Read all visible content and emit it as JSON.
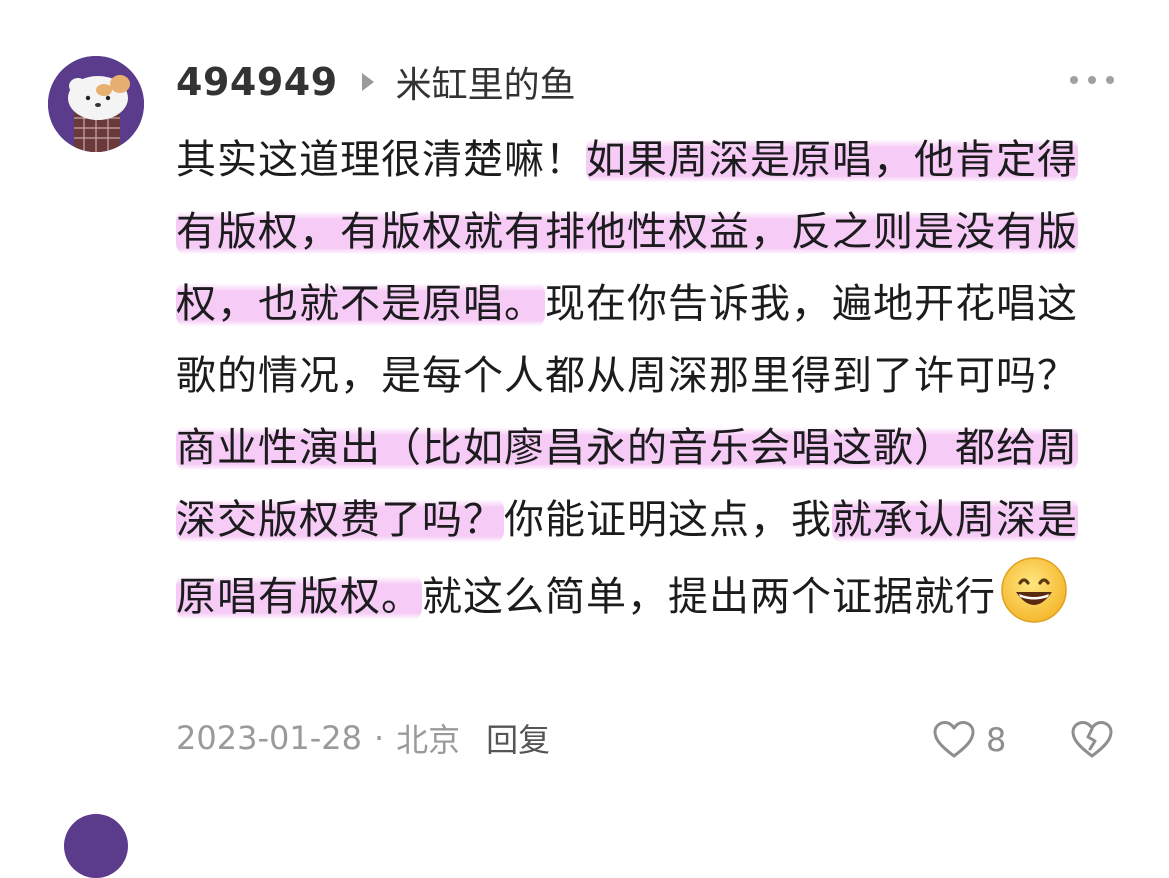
{
  "comment": {
    "username": "494949",
    "reply_to": "米缸里的鱼",
    "segments": [
      {
        "text": "其实这道理很清楚嘛！",
        "highlight": false
      },
      {
        "text": "如果周深是原唱，他肯定得有版权，有版权就有排他性权益，反之则是没有版权，也就不是原唱。",
        "highlight": true
      },
      {
        "text": "现在你告诉我，遍地开花唱这歌的情况，是每个人都从周深那里得到了许可吗？",
        "highlight": false
      },
      {
        "text": "商业性演出（比如廖昌永的音乐会唱这歌）都给周深交版权费了吗？",
        "highlight": true
      },
      {
        "text": "你能证明这点，我",
        "highlight": false
      },
      {
        "text": "就承认周深是原唱有版权。",
        "highlight": true
      },
      {
        "text": "就这么简单，提出两个证据就行",
        "highlight": false
      }
    ],
    "emoji": "grinning-face-emoji",
    "date": "2023-01-28",
    "separator": "·",
    "location": "北京",
    "reply_label": "回复",
    "like_count": "8"
  },
  "icons": {
    "reply_arrow": "triangle-right-icon",
    "more": "more-dots-icon",
    "like": "heart-icon",
    "dislike": "broken-heart-icon"
  },
  "colors": {
    "highlight": "#eea0ee",
    "avatar_bg": "#5b3b8c",
    "meta_text": "#9a9a9a"
  }
}
